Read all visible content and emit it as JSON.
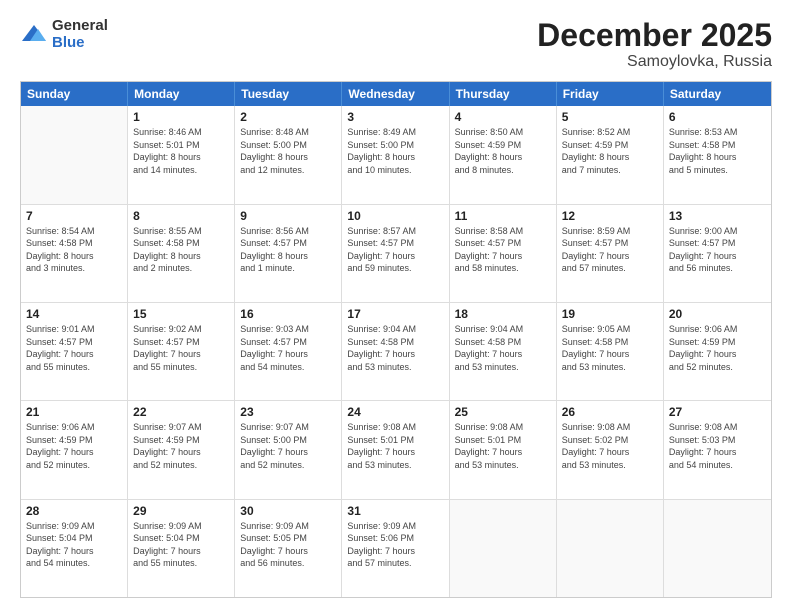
{
  "logo": {
    "general": "General",
    "blue": "Blue"
  },
  "title": "December 2025",
  "subtitle": "Samoylovka, Russia",
  "days": [
    "Sunday",
    "Monday",
    "Tuesday",
    "Wednesday",
    "Thursday",
    "Friday",
    "Saturday"
  ],
  "weeks": [
    [
      {
        "day": "",
        "info": ""
      },
      {
        "day": "1",
        "info": "Sunrise: 8:46 AM\nSunset: 5:01 PM\nDaylight: 8 hours\nand 14 minutes."
      },
      {
        "day": "2",
        "info": "Sunrise: 8:48 AM\nSunset: 5:00 PM\nDaylight: 8 hours\nand 12 minutes."
      },
      {
        "day": "3",
        "info": "Sunrise: 8:49 AM\nSunset: 5:00 PM\nDaylight: 8 hours\nand 10 minutes."
      },
      {
        "day": "4",
        "info": "Sunrise: 8:50 AM\nSunset: 4:59 PM\nDaylight: 8 hours\nand 8 minutes."
      },
      {
        "day": "5",
        "info": "Sunrise: 8:52 AM\nSunset: 4:59 PM\nDaylight: 8 hours\nand 7 minutes."
      },
      {
        "day": "6",
        "info": "Sunrise: 8:53 AM\nSunset: 4:58 PM\nDaylight: 8 hours\nand 5 minutes."
      }
    ],
    [
      {
        "day": "7",
        "info": "Sunrise: 8:54 AM\nSunset: 4:58 PM\nDaylight: 8 hours\nand 3 minutes."
      },
      {
        "day": "8",
        "info": "Sunrise: 8:55 AM\nSunset: 4:58 PM\nDaylight: 8 hours\nand 2 minutes."
      },
      {
        "day": "9",
        "info": "Sunrise: 8:56 AM\nSunset: 4:57 PM\nDaylight: 8 hours\nand 1 minute."
      },
      {
        "day": "10",
        "info": "Sunrise: 8:57 AM\nSunset: 4:57 PM\nDaylight: 7 hours\nand 59 minutes."
      },
      {
        "day": "11",
        "info": "Sunrise: 8:58 AM\nSunset: 4:57 PM\nDaylight: 7 hours\nand 58 minutes."
      },
      {
        "day": "12",
        "info": "Sunrise: 8:59 AM\nSunset: 4:57 PM\nDaylight: 7 hours\nand 57 minutes."
      },
      {
        "day": "13",
        "info": "Sunrise: 9:00 AM\nSunset: 4:57 PM\nDaylight: 7 hours\nand 56 minutes."
      }
    ],
    [
      {
        "day": "14",
        "info": "Sunrise: 9:01 AM\nSunset: 4:57 PM\nDaylight: 7 hours\nand 55 minutes."
      },
      {
        "day": "15",
        "info": "Sunrise: 9:02 AM\nSunset: 4:57 PM\nDaylight: 7 hours\nand 55 minutes."
      },
      {
        "day": "16",
        "info": "Sunrise: 9:03 AM\nSunset: 4:57 PM\nDaylight: 7 hours\nand 54 minutes."
      },
      {
        "day": "17",
        "info": "Sunrise: 9:04 AM\nSunset: 4:58 PM\nDaylight: 7 hours\nand 53 minutes."
      },
      {
        "day": "18",
        "info": "Sunrise: 9:04 AM\nSunset: 4:58 PM\nDaylight: 7 hours\nand 53 minutes."
      },
      {
        "day": "19",
        "info": "Sunrise: 9:05 AM\nSunset: 4:58 PM\nDaylight: 7 hours\nand 53 minutes."
      },
      {
        "day": "20",
        "info": "Sunrise: 9:06 AM\nSunset: 4:59 PM\nDaylight: 7 hours\nand 52 minutes."
      }
    ],
    [
      {
        "day": "21",
        "info": "Sunrise: 9:06 AM\nSunset: 4:59 PM\nDaylight: 7 hours\nand 52 minutes."
      },
      {
        "day": "22",
        "info": "Sunrise: 9:07 AM\nSunset: 4:59 PM\nDaylight: 7 hours\nand 52 minutes."
      },
      {
        "day": "23",
        "info": "Sunrise: 9:07 AM\nSunset: 5:00 PM\nDaylight: 7 hours\nand 52 minutes."
      },
      {
        "day": "24",
        "info": "Sunrise: 9:08 AM\nSunset: 5:01 PM\nDaylight: 7 hours\nand 53 minutes."
      },
      {
        "day": "25",
        "info": "Sunrise: 9:08 AM\nSunset: 5:01 PM\nDaylight: 7 hours\nand 53 minutes."
      },
      {
        "day": "26",
        "info": "Sunrise: 9:08 AM\nSunset: 5:02 PM\nDaylight: 7 hours\nand 53 minutes."
      },
      {
        "day": "27",
        "info": "Sunrise: 9:08 AM\nSunset: 5:03 PM\nDaylight: 7 hours\nand 54 minutes."
      }
    ],
    [
      {
        "day": "28",
        "info": "Sunrise: 9:09 AM\nSunset: 5:04 PM\nDaylight: 7 hours\nand 54 minutes."
      },
      {
        "day": "29",
        "info": "Sunrise: 9:09 AM\nSunset: 5:04 PM\nDaylight: 7 hours\nand 55 minutes."
      },
      {
        "day": "30",
        "info": "Sunrise: 9:09 AM\nSunset: 5:05 PM\nDaylight: 7 hours\nand 56 minutes."
      },
      {
        "day": "31",
        "info": "Sunrise: 9:09 AM\nSunset: 5:06 PM\nDaylight: 7 hours\nand 57 minutes."
      },
      {
        "day": "",
        "info": ""
      },
      {
        "day": "",
        "info": ""
      },
      {
        "day": "",
        "info": ""
      }
    ]
  ]
}
